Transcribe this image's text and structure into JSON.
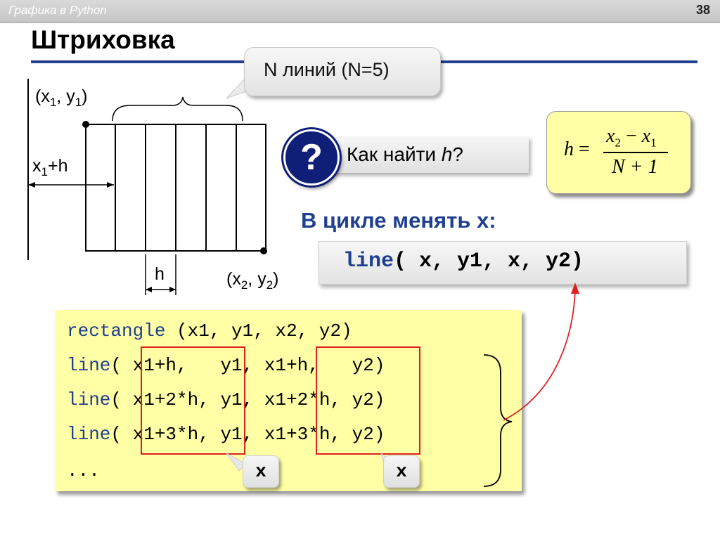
{
  "header": {
    "title": "Графика в Python",
    "slide_number": "38"
  },
  "slide": {
    "title": "Штриховка"
  },
  "callout_n": {
    "text": "N линий (N=5)"
  },
  "diagram": {
    "p1_text": "(x",
    "p1_sub1": "1",
    "p1_mid": ", y",
    "p1_sub2": "1",
    "p1_end": ")",
    "offset_text": "x",
    "offset_sub": "1",
    "offset_end": "+h",
    "h_label": "h",
    "p2_text": "(x",
    "p2_sub1": "2",
    "p2_mid": ", y",
    "p2_sub2": "2",
    "p2_end": ")"
  },
  "question": {
    "icon": "?",
    "text_main": "Как найти ",
    "text_var": "h",
    "text_end": "?"
  },
  "formula": {
    "lhs": "h",
    "eq": "=",
    "num_a": "x",
    "num_a_sub": "2",
    "num_op": "−",
    "num_b": "x",
    "num_b_sub": "1",
    "den": "N + 1"
  },
  "cycle": {
    "heading": "В цикле менять x:",
    "code_kw": "line",
    "code_rest": "( x, y1, x, y2)"
  },
  "code_lines": [
    {
      "kw": "rectangle",
      "rest": " (x1, y1, x2, y2)"
    },
    {
      "kw": "line",
      "rest": "( x1+h,   y1, x1+h,   y2)"
    },
    {
      "kw": "line",
      "rest": "( x1+2*h, y1, x1+2*h, y2)"
    },
    {
      "kw": "line",
      "rest": "( x1+3*h, y1, x1+3*h, y2)"
    },
    {
      "kw": "",
      "rest": "..."
    }
  ],
  "tags": {
    "left": "x",
    "right": "x"
  },
  "colors": {
    "accent": "#1f3f8f",
    "highlight": "#ffffa6",
    "red": "#e02020"
  }
}
